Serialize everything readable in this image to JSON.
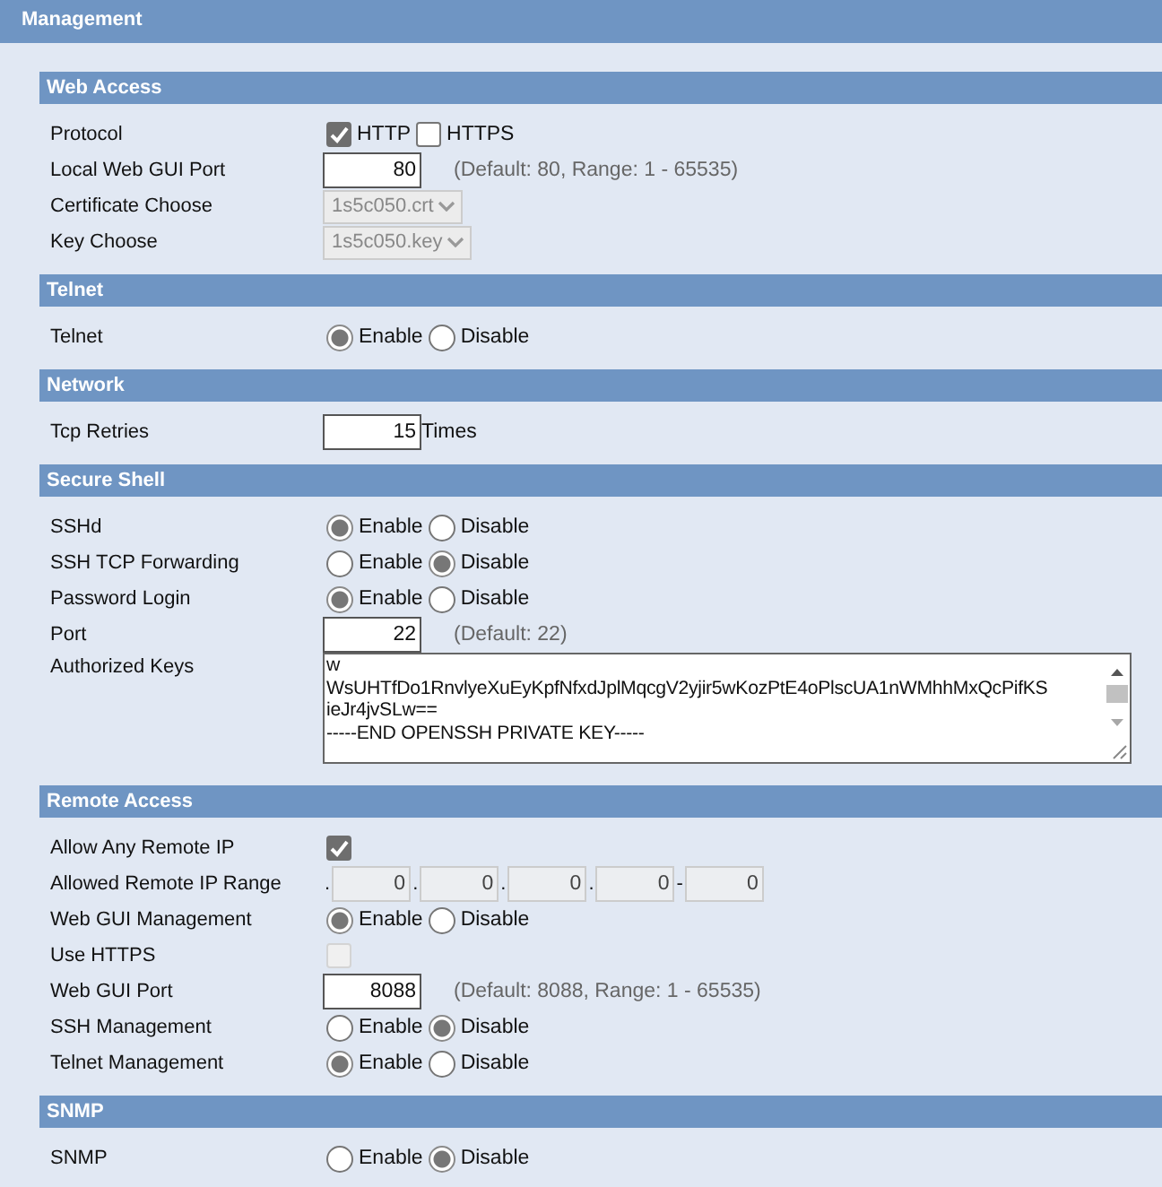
{
  "title": "Management",
  "sections": [
    {
      "title": "Web Access",
      "rows": [
        {
          "kind": "checks",
          "label": "Protocol",
          "options": [
            {
              "label": "HTTP",
              "checked": true
            },
            {
              "label": "HTTPS",
              "checked": false
            }
          ]
        },
        {
          "kind": "number",
          "label": "Local Web GUI Port",
          "value": "80",
          "note": "(Default: 80, Range: 1 - 65535)"
        },
        {
          "kind": "select",
          "label": "Certificate Choose",
          "value": "1s5c050.crt",
          "disabled": true
        },
        {
          "kind": "select",
          "label": "Key Choose",
          "value": "1s5c050.key",
          "disabled": true
        }
      ]
    },
    {
      "title": "Telnet",
      "rows": [
        {
          "kind": "radio",
          "label": "Telnet",
          "options": [
            {
              "label": "Enable",
              "selected": true
            },
            {
              "label": "Disable",
              "selected": false
            }
          ]
        }
      ]
    },
    {
      "title": "Network",
      "rows": [
        {
          "kind": "number",
          "label": "Tcp Retries",
          "value": "15",
          "unit": "Times"
        }
      ]
    },
    {
      "title": "Secure Shell",
      "rows": [
        {
          "kind": "radio",
          "label": "SSHd",
          "options": [
            {
              "label": "Enable",
              "selected": true
            },
            {
              "label": "Disable",
              "selected": false
            }
          ]
        },
        {
          "kind": "radio",
          "label": "SSH TCP Forwarding",
          "options": [
            {
              "label": "Enable",
              "selected": false
            },
            {
              "label": "Disable",
              "selected": true
            }
          ]
        },
        {
          "kind": "radio",
          "label": "Password Login",
          "options": [
            {
              "label": "Enable",
              "selected": true
            },
            {
              "label": "Disable",
              "selected": false
            }
          ]
        },
        {
          "kind": "number",
          "label": "Port",
          "value": "22",
          "note": "(Default: 22)"
        },
        {
          "kind": "textarea",
          "label": "Authorized Keys",
          "lines": [
            "w",
            "WsUHTfDo1RnvlyeXuEyKpfNfxdJplMqcgV2yjir5wKozPtE4oPlscUA1nWMhhMxQcPifKS",
            "ieJr4jvSLw==",
            "-----END OPENSSH PRIVATE KEY-----"
          ]
        }
      ]
    },
    {
      "title": "Remote Access",
      "rows": [
        {
          "kind": "check",
          "label": "Allow Any Remote IP",
          "checked": true,
          "disabled": false
        },
        {
          "kind": "iprange",
          "label": "Allowed Remote IP Range",
          "parts": [
            {
              "kind": "sep",
              "text": "."
            },
            {
              "kind": "field",
              "value": "0"
            },
            {
              "kind": "sep",
              "text": "."
            },
            {
              "kind": "field",
              "value": "0"
            },
            {
              "kind": "sep",
              "text": "."
            },
            {
              "kind": "field",
              "value": "0"
            },
            {
              "kind": "sep",
              "text": "."
            },
            {
              "kind": "field",
              "value": "0"
            },
            {
              "kind": "sep",
              "text": "-"
            },
            {
              "kind": "field",
              "value": "0"
            }
          ]
        },
        {
          "kind": "radio",
          "label": "Web GUI Management",
          "options": [
            {
              "label": "Enable",
              "selected": true
            },
            {
              "label": "Disable",
              "selected": false
            }
          ]
        },
        {
          "kind": "check",
          "label": "Use HTTPS",
          "checked": false,
          "disabled": true
        },
        {
          "kind": "number",
          "label": "Web GUI Port",
          "value": "8088",
          "note": "(Default: 8088, Range: 1 - 65535)"
        },
        {
          "kind": "radio",
          "label": "SSH Management",
          "options": [
            {
              "label": "Enable",
              "selected": false
            },
            {
              "label": "Disable",
              "selected": true
            }
          ]
        },
        {
          "kind": "radio",
          "label": "Telnet Management",
          "options": [
            {
              "label": "Enable",
              "selected": true
            },
            {
              "label": "Disable",
              "selected": false
            }
          ]
        }
      ]
    },
    {
      "title": "SNMP",
      "rows": [
        {
          "kind": "radio",
          "label": "SNMP",
          "options": [
            {
              "label": "Enable",
              "selected": false
            },
            {
              "label": "Disable",
              "selected": true
            }
          ]
        }
      ]
    }
  ]
}
